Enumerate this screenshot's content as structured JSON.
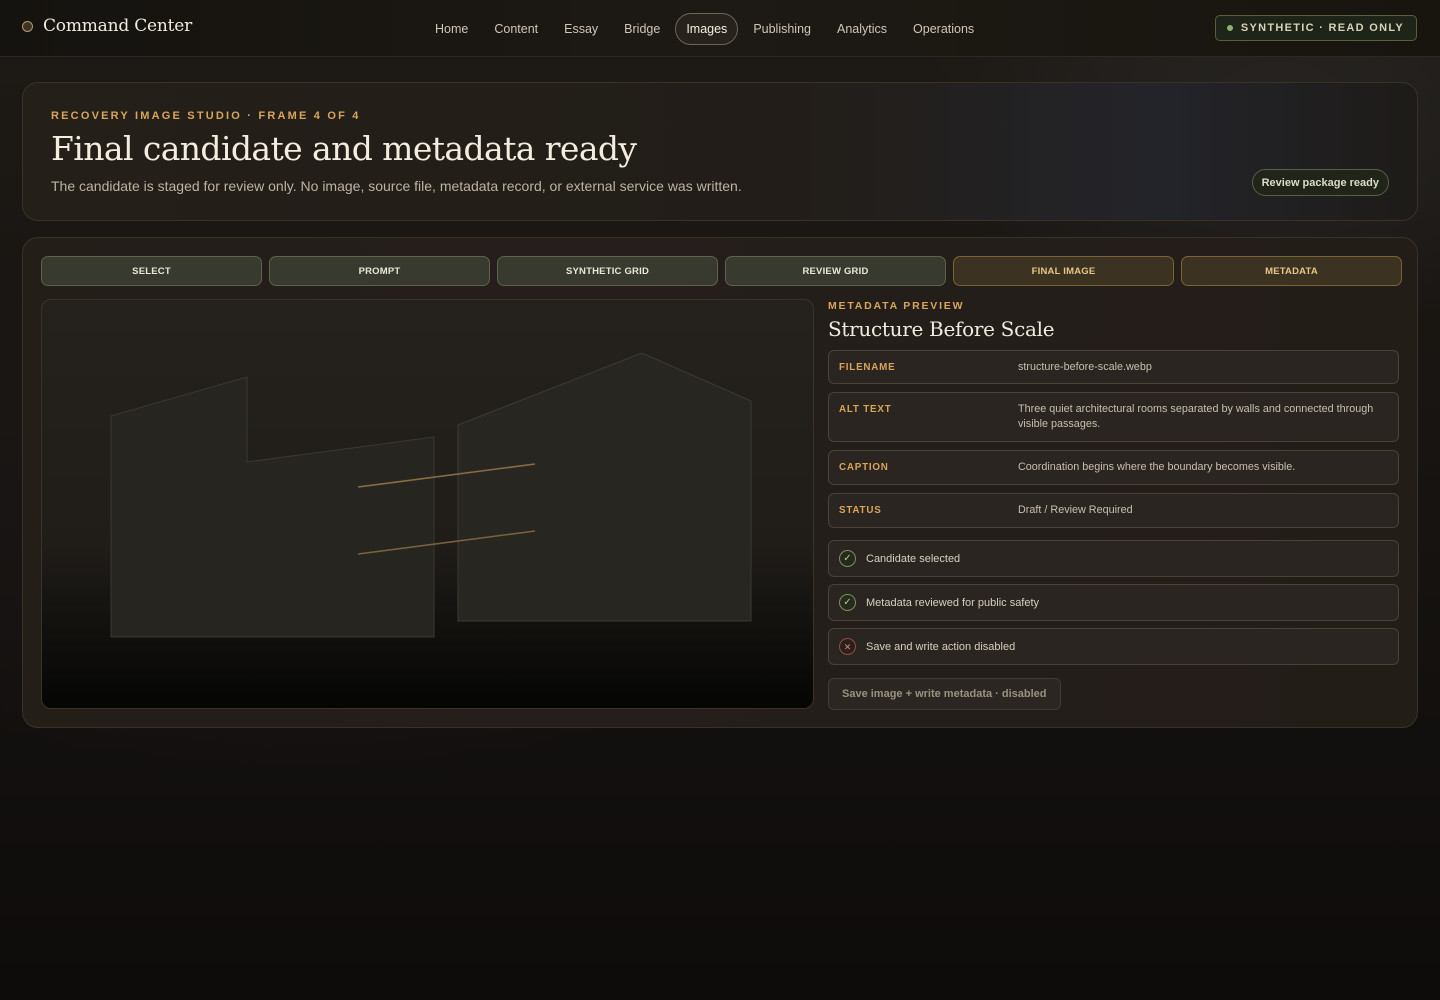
{
  "app": {
    "title": "Command Center"
  },
  "nav": {
    "items": [
      {
        "label": "Home"
      },
      {
        "label": "Content"
      },
      {
        "label": "Essay"
      },
      {
        "label": "Bridge"
      },
      {
        "label": "Images",
        "active": true
      },
      {
        "label": "Publishing"
      },
      {
        "label": "Analytics"
      },
      {
        "label": "Operations"
      }
    ]
  },
  "mode_badge": {
    "label": "SYNTHETIC · READ ONLY",
    "color": "#8fb06a"
  },
  "hero": {
    "kicker": "RECOVERY IMAGE STUDIO · FRAME 4 OF 4",
    "title": "Final candidate and metadata ready",
    "subtitle": "The candidate is staged for review only. No image, source file, metadata record, or external service was written.",
    "status_pill": "Review package ready"
  },
  "steps": [
    {
      "label": "SELECT",
      "state": "done"
    },
    {
      "label": "PROMPT",
      "state": "done"
    },
    {
      "label": "SYNTHETIC GRID",
      "state": "done"
    },
    {
      "label": "REVIEW GRID",
      "state": "done"
    },
    {
      "label": "FINAL IMAGE",
      "state": "current"
    },
    {
      "label": "METADATA",
      "state": "current"
    }
  ],
  "metadata": {
    "kicker": "METADATA PREVIEW",
    "title": "Structure Before Scale",
    "fields": [
      {
        "key": "FILENAME",
        "value": "structure-before-scale.webp"
      },
      {
        "key": "ALT TEXT",
        "value": "Three quiet architectural rooms separated by walls and connected through visible passages."
      },
      {
        "key": "CAPTION",
        "value": "Coordination begins where the boundary becomes visible."
      },
      {
        "key": "STATUS",
        "value": "Draft / Review Required"
      }
    ],
    "checks": [
      {
        "label": "Candidate selected",
        "ok": true,
        "icon": "check-icon"
      },
      {
        "label": "Metadata reviewed for public safety",
        "ok": true,
        "icon": "check-icon"
      },
      {
        "label": "Save and write action disabled",
        "ok": false,
        "icon": "x-icon"
      }
    ],
    "save_button": "Save image + write metadata · disabled"
  },
  "colors": {
    "accent": "#d8a55a",
    "ok": "#8fb06a",
    "danger": "#d48a7c"
  }
}
